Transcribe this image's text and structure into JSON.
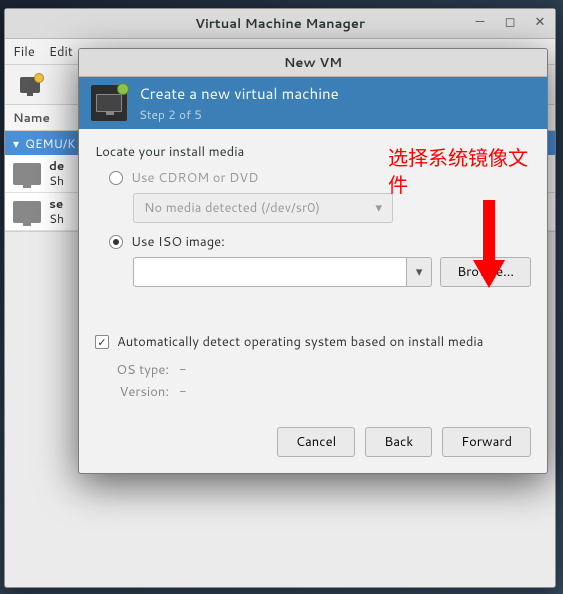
{
  "mainWindow": {
    "title": "Virtual Machine Manager",
    "menubar": {
      "file": "File",
      "edit": "Edit"
    },
    "listHeader": "Name",
    "group": "QEMU/K",
    "vms": [
      {
        "name": "de",
        "state": "Sh"
      },
      {
        "name": "se",
        "state": "Sh"
      }
    ]
  },
  "dialog": {
    "title": "New VM",
    "banner": {
      "heading": "Create a new virtual machine",
      "step": "Step 2 of 5"
    },
    "locate_label": "Locate your install media",
    "radio_cdrom": "Use CDROM or DVD",
    "cdrom_combo": "No media detected (/dev/sr0)",
    "radio_iso": "Use ISO image:",
    "iso_value": "",
    "browse_label": "Browse...",
    "autodetect_label": "Automatically detect operating system based on install media",
    "os_type_k": "OS type:",
    "os_type_v": "-",
    "version_k": "Version:",
    "version_v": "-",
    "buttons": {
      "cancel": "Cancel",
      "back": "Back",
      "forward": "Forward"
    }
  },
  "annotation": {
    "line1": "选择系统镜像文",
    "line2": "件"
  }
}
